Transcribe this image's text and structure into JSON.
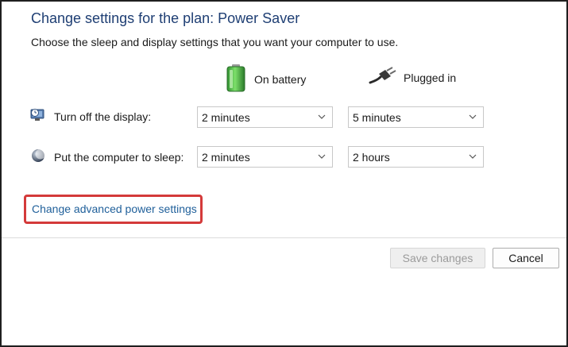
{
  "title": "Change settings for the plan: Power Saver",
  "subtitle": "Choose the sleep and display settings that you want your computer to use.",
  "columns": {
    "battery": {
      "label": "On battery",
      "icon": "battery-icon"
    },
    "plugged": {
      "label": "Plugged in",
      "icon": "power-plug-icon"
    }
  },
  "rows": {
    "display": {
      "label": "Turn off the display:",
      "icon": "monitor-clock-icon",
      "battery_value": "2 minutes",
      "plugged_value": "5 minutes"
    },
    "sleep": {
      "label": "Put the computer to sleep:",
      "icon": "moon-icon",
      "battery_value": "2 minutes",
      "plugged_value": "2 hours"
    }
  },
  "advanced_link": "Change advanced power settings",
  "buttons": {
    "save": "Save changes",
    "cancel": "Cancel"
  },
  "colors": {
    "title": "#1e3e73",
    "link": "#1f5f9a",
    "highlight": "#d43a3a"
  }
}
